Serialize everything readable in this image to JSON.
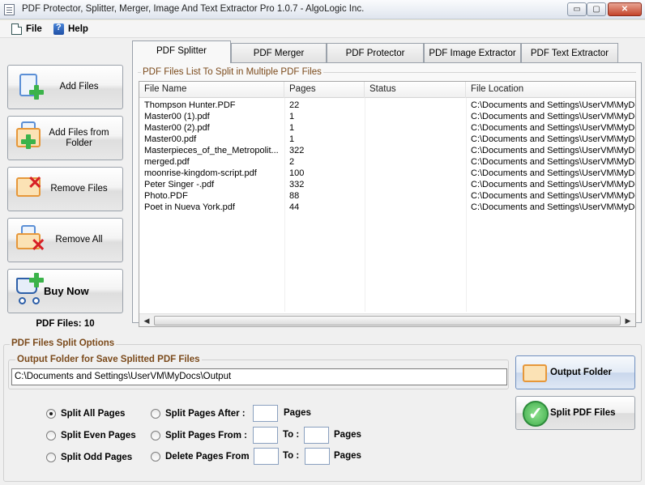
{
  "window": {
    "title": "PDF Protector, Splitter, Merger, Image And Text Extractor Pro 1.0.7 - AlgoLogic Inc.",
    "min_glyph": "▭",
    "max_glyph": "▢",
    "close_glyph": "✕"
  },
  "menu": {
    "file": "File",
    "help": "Help"
  },
  "sidebar": {
    "add_files": "Add Files",
    "add_files_from_folder": "Add Files from Folder",
    "remove_files": "Remove Files",
    "remove_all": "Remove All",
    "buy_now": "Buy Now",
    "file_count": "PDF Files: 10"
  },
  "tabs": [
    "PDF Splitter",
    "PDF Merger",
    "PDF Protector",
    "PDF Image Extractor",
    "PDF Text Extractor"
  ],
  "list": {
    "group_label": "PDF Files List To Split in Multiple PDF Files",
    "columns": [
      "File Name",
      "Pages",
      "Status",
      "File Location"
    ],
    "rows": [
      [
        "Thompson Hunter.PDF",
        "22",
        "",
        "C:\\Documents and Settings\\UserVM\\MyDo"
      ],
      [
        "Master00 (1).pdf",
        "1",
        "",
        "C:\\Documents and Settings\\UserVM\\MyDo"
      ],
      [
        "Master00 (2).pdf",
        "1",
        "",
        "C:\\Documents and Settings\\UserVM\\MyDo"
      ],
      [
        "Master00.pdf",
        "1",
        "",
        "C:\\Documents and Settings\\UserVM\\MyDo"
      ],
      [
        "Masterpieces_of_the_Metropolit...",
        "322",
        "",
        "C:\\Documents and Settings\\UserVM\\MyDo"
      ],
      [
        "merged.pdf",
        "2",
        "",
        "C:\\Documents and Settings\\UserVM\\MyDo"
      ],
      [
        "moonrise-kingdom-script.pdf",
        "100",
        "",
        "C:\\Documents and Settings\\UserVM\\MyDo"
      ],
      [
        "Peter Singer -.pdf",
        "332",
        "",
        "C:\\Documents and Settings\\UserVM\\MyDo"
      ],
      [
        "Photo.PDF",
        "88",
        "",
        "C:\\Documents and Settings\\UserVM\\MyDo"
      ],
      [
        "Poet in Nueva York.pdf",
        "44",
        "",
        "C:\\Documents and Settings\\UserVM\\MyDo"
      ]
    ]
  },
  "options": {
    "title": "PDF Files Split Options",
    "output_label": "Output Folder for Save Splitted PDF Files",
    "output_path": "C:\\Documents and Settings\\UserVM\\MyDocs\\Output",
    "output_button": "Output Folder",
    "split_button": "Split PDF Files",
    "split_all": "Split All Pages",
    "split_even": "Split Even Pages",
    "split_odd": "Split Odd Pages",
    "split_after": "Split Pages  After :",
    "split_from": "Split Pages  From :",
    "delete_from": "Delete Pages  From",
    "to": "To :",
    "pages": "Pages",
    "selected": "Split All Pages"
  }
}
